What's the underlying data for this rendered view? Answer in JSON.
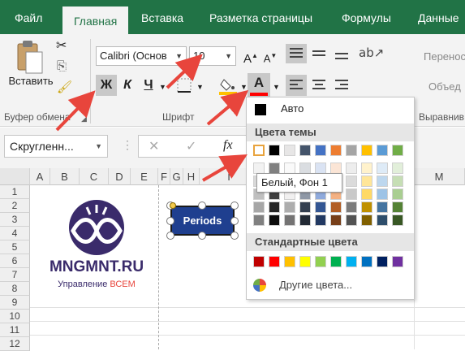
{
  "tabs": [
    "Файл",
    "Главная",
    "Вставка",
    "Разметка страницы",
    "Формулы",
    "Данные"
  ],
  "clipboard": {
    "paste_label": "Вставить",
    "group_label": "Буфер обмена"
  },
  "font": {
    "name": "Calibri (Основ",
    "size": "10",
    "bold": "Ж",
    "italic": "К",
    "underline": "Ч",
    "font_color_letter": "А",
    "grow": "А",
    "shrink": "А",
    "group_label": "Шрифт"
  },
  "alignment": {
    "wrap_label": "Перенос",
    "merge_label": "Объед",
    "group_label": "Выравнив"
  },
  "formula_bar": {
    "name_box": "Скругленн...",
    "fx": "fx"
  },
  "grid": {
    "columns": [
      "A",
      "B",
      "C",
      "D",
      "E",
      "F",
      "G",
      "H",
      "I",
      "M"
    ],
    "rows": [
      "1",
      "2",
      "3",
      "4",
      "5",
      "6",
      "7",
      "8",
      "9",
      "10",
      "11",
      "12"
    ]
  },
  "logo": {
    "brand": "MNGMNT.RU",
    "tagline_prefix": "Управление",
    "tagline_highlight": "ВСЕМ"
  },
  "shape": {
    "text": "Periods"
  },
  "color_menu": {
    "auto_label": "Авто",
    "theme_header": "Цвета темы",
    "standard_header": "Стандартные цвета",
    "more_colors": "Другие цвета...",
    "theme_colors": [
      "#ffffff",
      "#000000",
      "#e7e6e6",
      "#44546a",
      "#4472c4",
      "#ed7d31",
      "#a5a5a5",
      "#ffc000",
      "#5b9bd5",
      "#70ad47"
    ],
    "standard_colors": [
      "#c00000",
      "#ff0000",
      "#ffc000",
      "#ffff00",
      "#92d050",
      "#00b050",
      "#00b0f0",
      "#0070c0",
      "#002060",
      "#7030a0"
    ],
    "tooltip": "Белый, Фон 1"
  },
  "colors": {
    "accent": "#217346",
    "fill_highlight": "#ffc000",
    "font_color": "#ff0000",
    "arrow": "#e8453c",
    "logo": "#3a2b6b"
  }
}
